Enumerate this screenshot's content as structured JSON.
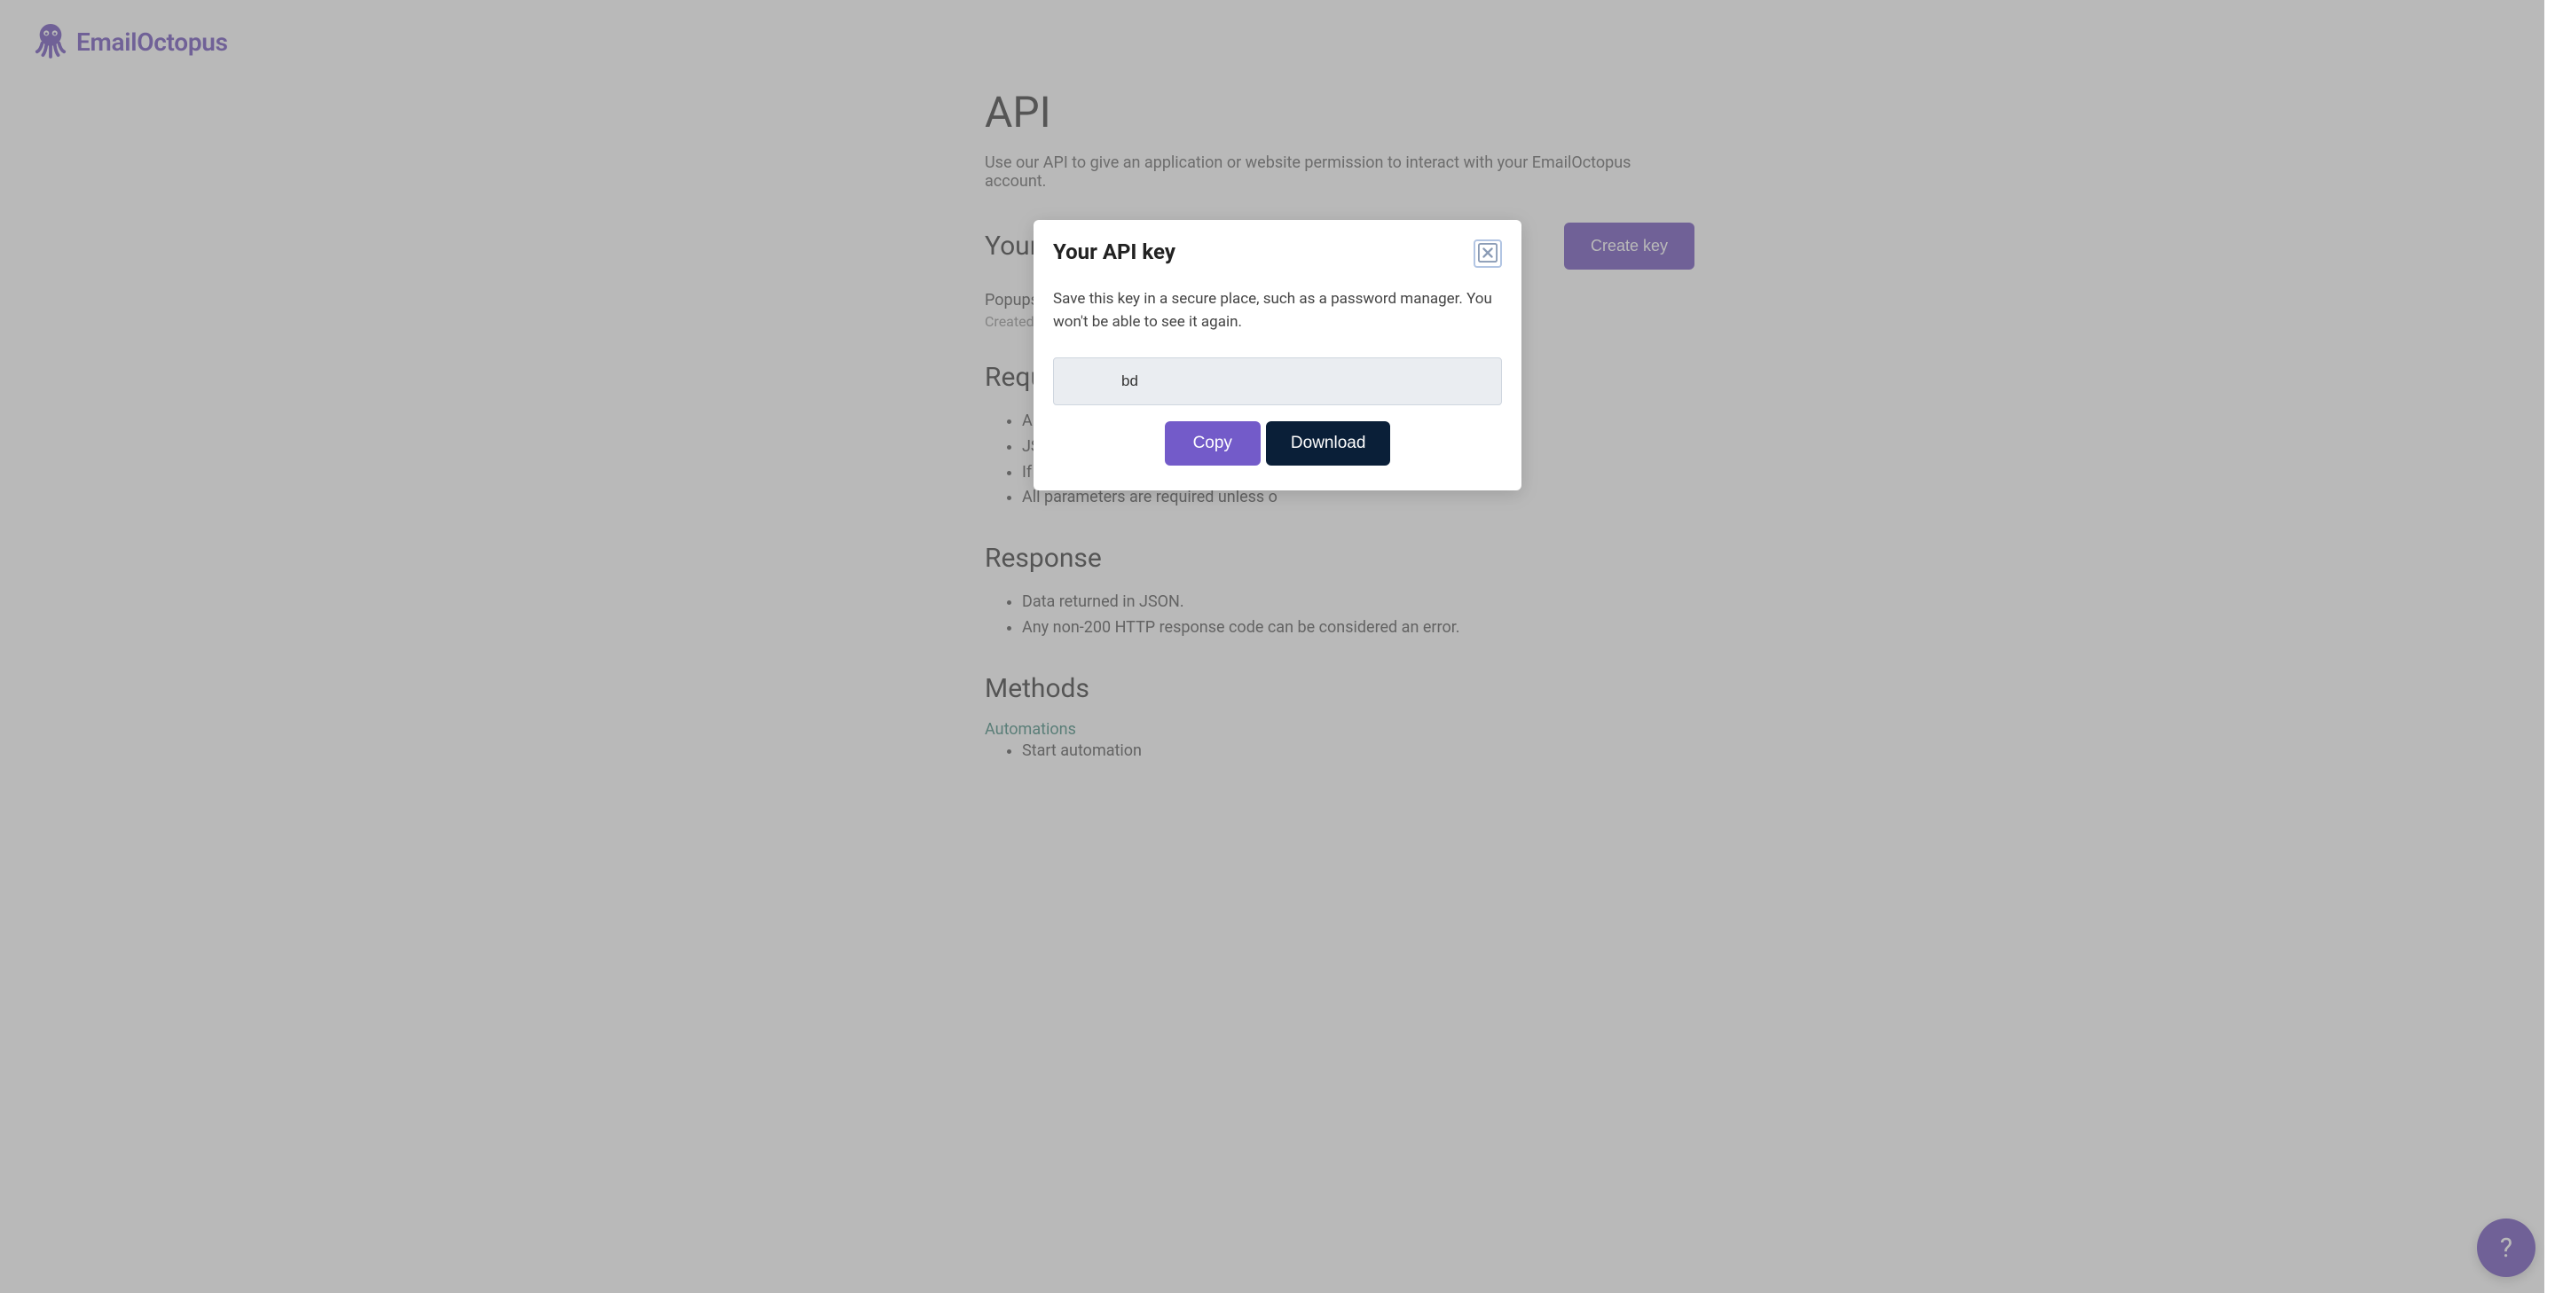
{
  "brand": {
    "name": "EmailOctopus"
  },
  "page": {
    "title": "API",
    "subtitle": "Use our API to give an application or website permission to interact with your EmailOctopus account."
  },
  "keys": {
    "heading": "Your keys",
    "create_label": "Create key",
    "items": [
      {
        "name": "Popupsmart & EmailOctopus Integration (e",
        "created": "Created just now"
      }
    ]
  },
  "requests": {
    "heading": "Requests",
    "bullets": [
      "All requests should be made using H",
      "JSON objects are recommended for ",
      "If you're making a JSON request, inc",
      "All parameters are required unless o"
    ]
  },
  "response": {
    "heading": "Response",
    "bullets": [
      "Data returned in JSON.",
      "Any non-200 HTTP response code can be considered an error."
    ]
  },
  "methods": {
    "heading": "Methods",
    "category": "Automations",
    "items": [
      "Start automation"
    ]
  },
  "modal": {
    "title": "Your API key",
    "description": "Save this key in a secure place, such as a password manager. You won't be able to see it again.",
    "key_value": "bd",
    "copy_label": "Copy",
    "download_label": "Download"
  },
  "help": {
    "label": "?"
  }
}
